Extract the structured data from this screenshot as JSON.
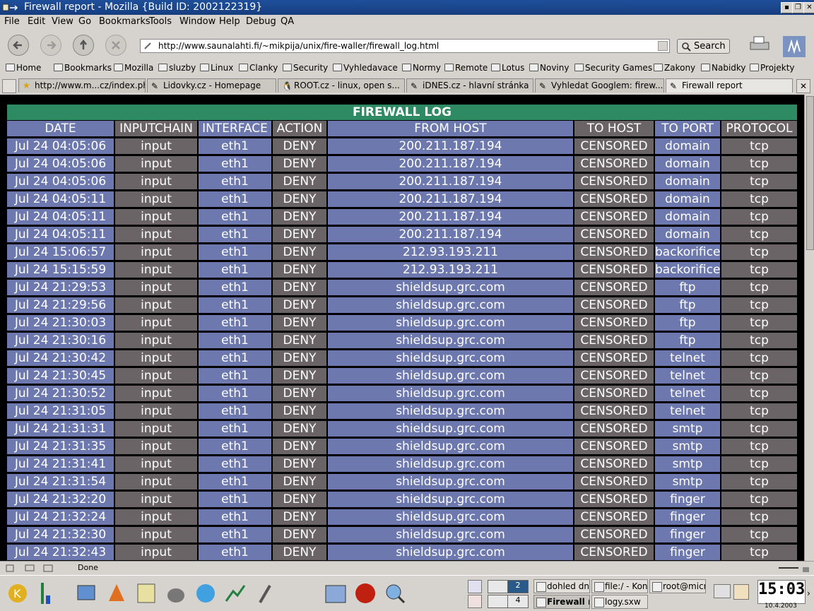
{
  "window": {
    "title": "Firewall report - Mozilla {Build ID: 2002122319}"
  },
  "menu": [
    "File",
    "Edit",
    "View",
    "Go",
    "Bookmarks",
    "Tools",
    "Window",
    "Help",
    "Debug",
    "QA"
  ],
  "nav": {
    "url": "http://www.saunalahti.fi/~mikpija/unix/fire-waller/firewall_log.html",
    "search_label": "Search"
  },
  "bookmarks": [
    "Home",
    "Bookmarks",
    "Mozilla",
    "sluzby",
    "Linux",
    "Clanky",
    "Security",
    "Vyhledavace",
    "Normy",
    "Remote",
    "Lotus",
    "Noviny",
    "Security Games",
    "Zakony",
    "Nabidky",
    "Projekty"
  ],
  "tabs": [
    "http://www.m...cz/index.php",
    "Lidovky.cz - Homepage",
    "ROOT.cz - linux, open s...",
    "iDNES.cz - hlavní stránka",
    "Vyhledat Googlem: firew...",
    "Firewall report"
  ],
  "page": {
    "title": "FIREWALL LOG",
    "columns": [
      "DATE",
      "INPUTCHAIN",
      "INTERFACE",
      "ACTION",
      "FROM HOST",
      "TO HOST",
      "TO PORT",
      "PROTOCOL"
    ],
    "rows": [
      [
        "Jul 24 04:05:06",
        "input",
        "eth1",
        "DENY",
        "200.211.187.194",
        "CENSORED",
        "domain",
        "tcp"
      ],
      [
        "Jul 24 04:05:06",
        "input",
        "eth1",
        "DENY",
        "200.211.187.194",
        "CENSORED",
        "domain",
        "tcp"
      ],
      [
        "Jul 24 04:05:06",
        "input",
        "eth1",
        "DENY",
        "200.211.187.194",
        "CENSORED",
        "domain",
        "tcp"
      ],
      [
        "Jul 24 04:05:11",
        "input",
        "eth1",
        "DENY",
        "200.211.187.194",
        "CENSORED",
        "domain",
        "tcp"
      ],
      [
        "Jul 24 04:05:11",
        "input",
        "eth1",
        "DENY",
        "200.211.187.194",
        "CENSORED",
        "domain",
        "tcp"
      ],
      [
        "Jul 24 04:05:11",
        "input",
        "eth1",
        "DENY",
        "200.211.187.194",
        "CENSORED",
        "domain",
        "tcp"
      ],
      [
        "Jul 24 15:06:57",
        "input",
        "eth1",
        "DENY",
        "212.93.193.211",
        "CENSORED",
        "backorifice",
        "tcp"
      ],
      [
        "Jul 24 15:15:59",
        "input",
        "eth1",
        "DENY",
        "212.93.193.211",
        "CENSORED",
        "backorifice",
        "tcp"
      ],
      [
        "Jul 24 21:29:53",
        "input",
        "eth1",
        "DENY",
        "shieldsup.grc.com",
        "CENSORED",
        "ftp",
        "tcp"
      ],
      [
        "Jul 24 21:29:56",
        "input",
        "eth1",
        "DENY",
        "shieldsup.grc.com",
        "CENSORED",
        "ftp",
        "tcp"
      ],
      [
        "Jul 24 21:30:03",
        "input",
        "eth1",
        "DENY",
        "shieldsup.grc.com",
        "CENSORED",
        "ftp",
        "tcp"
      ],
      [
        "Jul 24 21:30:16",
        "input",
        "eth1",
        "DENY",
        "shieldsup.grc.com",
        "CENSORED",
        "ftp",
        "tcp"
      ],
      [
        "Jul 24 21:30:42",
        "input",
        "eth1",
        "DENY",
        "shieldsup.grc.com",
        "CENSORED",
        "telnet",
        "tcp"
      ],
      [
        "Jul 24 21:30:45",
        "input",
        "eth1",
        "DENY",
        "shieldsup.grc.com",
        "CENSORED",
        "telnet",
        "tcp"
      ],
      [
        "Jul 24 21:30:52",
        "input",
        "eth1",
        "DENY",
        "shieldsup.grc.com",
        "CENSORED",
        "telnet",
        "tcp"
      ],
      [
        "Jul 24 21:31:05",
        "input",
        "eth1",
        "DENY",
        "shieldsup.grc.com",
        "CENSORED",
        "telnet",
        "tcp"
      ],
      [
        "Jul 24 21:31:31",
        "input",
        "eth1",
        "DENY",
        "shieldsup.grc.com",
        "CENSORED",
        "smtp",
        "tcp"
      ],
      [
        "Jul 24 21:31:35",
        "input",
        "eth1",
        "DENY",
        "shieldsup.grc.com",
        "CENSORED",
        "smtp",
        "tcp"
      ],
      [
        "Jul 24 21:31:41",
        "input",
        "eth1",
        "DENY",
        "shieldsup.grc.com",
        "CENSORED",
        "smtp",
        "tcp"
      ],
      [
        "Jul 24 21:31:54",
        "input",
        "eth1",
        "DENY",
        "shieldsup.grc.com",
        "CENSORED",
        "smtp",
        "tcp"
      ],
      [
        "Jul 24 21:32:20",
        "input",
        "eth1",
        "DENY",
        "shieldsup.grc.com",
        "CENSORED",
        "finger",
        "tcp"
      ],
      [
        "Jul 24 21:32:24",
        "input",
        "eth1",
        "DENY",
        "shieldsup.grc.com",
        "CENSORED",
        "finger",
        "tcp"
      ],
      [
        "Jul 24 21:32:30",
        "input",
        "eth1",
        "DENY",
        "shieldsup.grc.com",
        "CENSORED",
        "finger",
        "tcp"
      ],
      [
        "Jul 24 21:32:43",
        "input",
        "eth1",
        "DENY",
        "shieldsup.grc.com",
        "CENSORED",
        "finger",
        "tcp"
      ]
    ]
  },
  "status": {
    "text": "Done"
  },
  "taskbar": {
    "desktops": [
      "2",
      "4"
    ],
    "tasks": [
      "dohled dn",
      "file:/ - Kon",
      "root@micr",
      "Firewall r",
      "logy.sxw"
    ],
    "clock": "15:03",
    "date": "10.4.2003"
  },
  "colors": {
    "title_bar": "#1f4f9a",
    "header_green": "#2e8a62",
    "cell_blue": "#6c78ae",
    "cell_gray": "#6a6466"
  }
}
